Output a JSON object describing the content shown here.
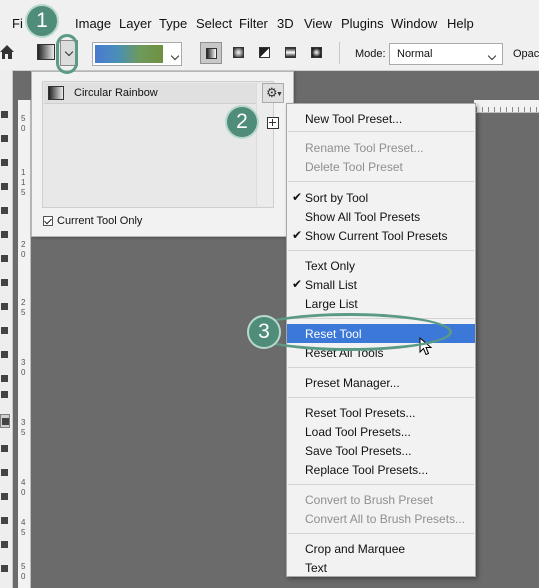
{
  "menubar": {
    "items": [
      "File",
      "Image",
      "Layer",
      "Type",
      "Select",
      "Filter",
      "3D",
      "View",
      "Plugins",
      "Window",
      "Help"
    ],
    "file_visible": "Fi"
  },
  "options_bar": {
    "mode_label": "Mode:",
    "mode_value": "Normal",
    "opacity_label": "Opaci",
    "gradient_colors": [
      "#4a7ad0",
      "#6f9040"
    ]
  },
  "presets_panel": {
    "presets": [
      "Circular Rainbow"
    ],
    "current_tool_only_label": "Current Tool Only",
    "current_tool_only_checked": true
  },
  "ruler": {
    "marks": [
      "5",
      "0",
      "1",
      "1",
      "5",
      "2",
      "0",
      "2",
      "5",
      "3",
      "0",
      "3",
      "5",
      "4",
      "0",
      "4",
      "5",
      "5",
      "0"
    ]
  },
  "context_menu": {
    "items": [
      {
        "label": "New Tool Preset...",
        "enabled": true,
        "checked": false,
        "highlighted": false
      },
      {
        "label": "Rename Tool Preset...",
        "enabled": false,
        "checked": false,
        "highlighted": false
      },
      {
        "label": "Delete Tool Preset",
        "enabled": false,
        "checked": false,
        "highlighted": false
      },
      {
        "label": "Sort by Tool",
        "enabled": true,
        "checked": true,
        "highlighted": false
      },
      {
        "label": "Show All Tool Presets",
        "enabled": true,
        "checked": false,
        "highlighted": false
      },
      {
        "label": "Show Current Tool Presets",
        "enabled": true,
        "checked": true,
        "highlighted": false
      },
      {
        "label": "Text Only",
        "enabled": true,
        "checked": false,
        "highlighted": false
      },
      {
        "label": "Small List",
        "enabled": true,
        "checked": true,
        "highlighted": false
      },
      {
        "label": "Large List",
        "enabled": true,
        "checked": false,
        "highlighted": false
      },
      {
        "label": "Reset Tool",
        "enabled": true,
        "checked": false,
        "highlighted": true
      },
      {
        "label": "Reset All Tools",
        "enabled": true,
        "checked": false,
        "highlighted": false
      },
      {
        "label": "Preset Manager...",
        "enabled": true,
        "checked": false,
        "highlighted": false
      },
      {
        "label": "Reset Tool Presets...",
        "enabled": true,
        "checked": false,
        "highlighted": false
      },
      {
        "label": "Load Tool Presets...",
        "enabled": true,
        "checked": false,
        "highlighted": false
      },
      {
        "label": "Save Tool Presets...",
        "enabled": true,
        "checked": false,
        "highlighted": false
      },
      {
        "label": "Replace Tool Presets...",
        "enabled": true,
        "checked": false,
        "highlighted": false
      },
      {
        "label": "Convert to Brush Preset",
        "enabled": false,
        "checked": false,
        "highlighted": false
      },
      {
        "label": "Convert All to Brush Presets...",
        "enabled": false,
        "checked": false,
        "highlighted": false
      },
      {
        "label": "Crop and Marquee",
        "enabled": true,
        "checked": false,
        "highlighted": false
      },
      {
        "label": "Text",
        "enabled": true,
        "checked": false,
        "highlighted": false
      }
    ]
  },
  "callouts": [
    "1",
    "2",
    "3"
  ],
  "colors": {
    "callout": "#4f8d7a",
    "highlight": "#3c78d8",
    "workspace": "#6b6b6b"
  }
}
